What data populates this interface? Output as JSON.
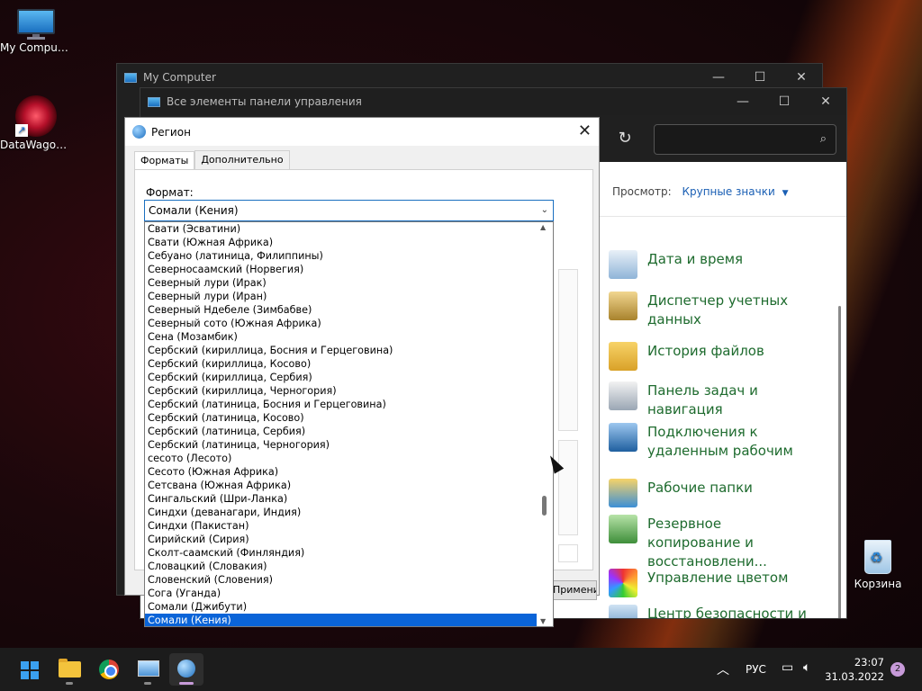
{
  "desktop": {
    "icons": [
      {
        "label": "My Computer"
      },
      {
        "label": "DataWagon..."
      },
      {
        "label": "Корзина"
      }
    ]
  },
  "mycomputer_window": {
    "title": "My Computer"
  },
  "controlpanel_window": {
    "title": "Все элементы панели управления",
    "view_label": "Просмотр:",
    "view_value": "Крупные значки",
    "items": [
      {
        "label": "Дата и время",
        "icon": "calendar-clock-icon"
      },
      {
        "label": "Диспетчер учетных данных",
        "icon": "credential-vault-icon"
      },
      {
        "label": "История файлов",
        "icon": "file-history-icon"
      },
      {
        "label": "Панель задач и навигация",
        "icon": "taskbar-icon"
      },
      {
        "label": "Подключения к удаленным рабочим",
        "icon": "remote-desktop-icon"
      },
      {
        "label": "Рабочие папки",
        "icon": "work-folders-icon"
      },
      {
        "label": "Резервное копирование и восстановлени...",
        "icon": "backup-restore-icon"
      },
      {
        "label": "Управление цветом",
        "icon": "color-management-icon"
      },
      {
        "label": "Центр безопасности и",
        "icon": "security-center-icon"
      }
    ]
  },
  "region_dialog": {
    "title": "Регион",
    "tabs": [
      {
        "label": "Форматы"
      },
      {
        "label": "Дополнительно"
      }
    ],
    "format_label": "Формат:",
    "format_value": "Сомали (Кения)",
    "apply_label": "Применить",
    "dropdown_items": [
      "Свати (Эсватини)",
      "Свати (Южная Африка)",
      "Себуано (латиница, Филиппины)",
      "Северносаамский (Норвегия)",
      "Северный лури (Ирак)",
      "Северный лури (Иран)",
      "Северный Ндебеле (Зимбабве)",
      "Северный сото (Южная Африка)",
      "Сена (Мозамбик)",
      "Сербский (кириллица, Босния и Герцеговина)",
      "Сербский (кириллица, Косово)",
      "Сербский (кириллица, Сербия)",
      "Сербский (кириллица, Черногория)",
      "Сербский (латиница, Босния и Герцеговина)",
      "Сербский (латиница, Косово)",
      "Сербский (латиница, Сербия)",
      "Сербский (латиница, Черногория)",
      "сесото (Лесото)",
      "Сесото (Южная Африка)",
      "Сетсвана (Южная Африка)",
      "Сингальский (Шри-Ланка)",
      "Синдхи (деванагари, Индия)",
      "Синдхи (Пакистан)",
      "Сирийский (Сирия)",
      "Сколт-саамский (Финляндия)",
      "Словацкий (Словакия)",
      "Словенский (Словения)",
      "Сога (Уганда)",
      "Сомали (Джибути)",
      "Сомали (Кения)"
    ],
    "selected_index": 29
  },
  "taskbar": {
    "lang": "РУС",
    "time": "23:07",
    "date": "31.03.2022",
    "notifications": "2"
  },
  "colors": {
    "accent": "#0a64d8",
    "link_green": "#1e6b2e",
    "taskbar": "#1c1c1c"
  }
}
